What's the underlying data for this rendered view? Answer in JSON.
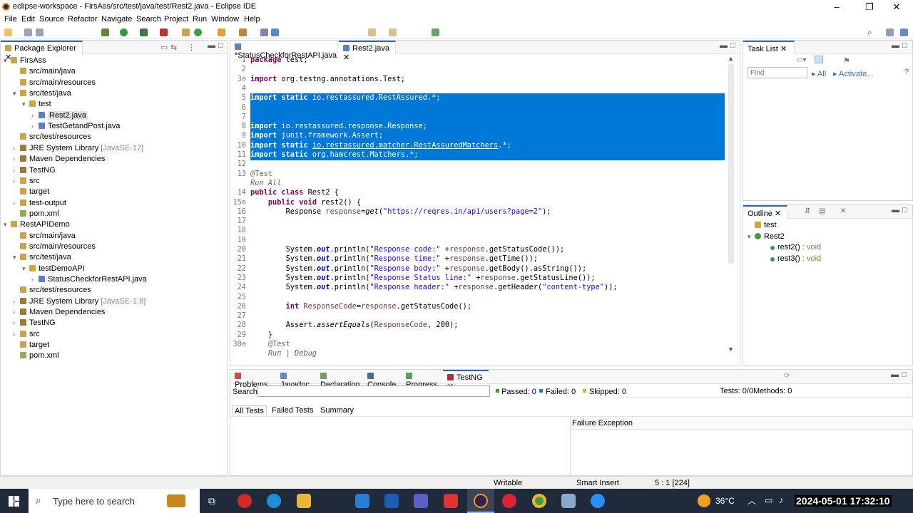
{
  "window": {
    "title": "eclipse-workspace - FirsAss/src/test/java/test/Rest2.java - Eclipse IDE"
  },
  "menu": [
    "File",
    "Edit",
    "Source",
    "Refactor",
    "Navigate",
    "Search",
    "Project",
    "Run",
    "Window",
    "Help"
  ],
  "package_explorer": {
    "title": "Package Explorer",
    "items": [
      {
        "label": "FirsAss",
        "depth": 0,
        "arrow": "▾",
        "icon": "project"
      },
      {
        "label": "src/main/java",
        "depth": 1,
        "arrow": "",
        "icon": "folder"
      },
      {
        "label": "src/main/resources",
        "depth": 1,
        "arrow": "",
        "icon": "folder"
      },
      {
        "label": "src/test/java",
        "depth": 1,
        "arrow": "▾",
        "icon": "folder"
      },
      {
        "label": "test",
        "depth": 2,
        "arrow": "▾",
        "icon": "package"
      },
      {
        "label": "Rest2.java",
        "depth": 3,
        "arrow": "›",
        "icon": "java",
        "selected": true
      },
      {
        "label": "TestGetandPost.java",
        "depth": 3,
        "arrow": "›",
        "icon": "java"
      },
      {
        "label": "src/test/resources",
        "depth": 1,
        "arrow": "",
        "icon": "folder"
      },
      {
        "label": "JRE System Library",
        "suffix": "[JavaSE-17]",
        "depth": 1,
        "arrow": "›",
        "icon": "library"
      },
      {
        "label": "Maven Dependencies",
        "depth": 1,
        "arrow": "›",
        "icon": "library"
      },
      {
        "label": "TestNG",
        "depth": 1,
        "arrow": "›",
        "icon": "library"
      },
      {
        "label": "src",
        "depth": 1,
        "arrow": "›",
        "icon": "folder"
      },
      {
        "label": "target",
        "depth": 1,
        "arrow": "",
        "icon": "folder"
      },
      {
        "label": "test-output",
        "depth": 1,
        "arrow": "›",
        "icon": "folder"
      },
      {
        "label": "pom.xml",
        "depth": 1,
        "arrow": "",
        "icon": "xml"
      },
      {
        "label": "RestAPIDemo",
        "depth": 0,
        "arrow": "▾",
        "icon": "project"
      },
      {
        "label": "src/main/java",
        "depth": 1,
        "arrow": "",
        "icon": "folder"
      },
      {
        "label": "src/main/resources",
        "depth": 1,
        "arrow": "",
        "icon": "folder"
      },
      {
        "label": "src/test/java",
        "depth": 1,
        "arrow": "▾",
        "icon": "folder"
      },
      {
        "label": "testDemoAPI",
        "depth": 2,
        "arrow": "▾",
        "icon": "package"
      },
      {
        "label": "StatusCheckforRestAPI.java",
        "depth": 3,
        "arrow": "›",
        "icon": "java"
      },
      {
        "label": "src/test/resources",
        "depth": 1,
        "arrow": "",
        "icon": "folder"
      },
      {
        "label": "JRE System Library",
        "suffix": "[JavaSE-1.8]",
        "depth": 1,
        "arrow": "›",
        "icon": "library"
      },
      {
        "label": "Maven Dependencies",
        "depth": 1,
        "arrow": "›",
        "icon": "library"
      },
      {
        "label": "TestNG",
        "depth": 1,
        "arrow": "›",
        "icon": "library"
      },
      {
        "label": "src",
        "depth": 1,
        "arrow": "›",
        "icon": "folder"
      },
      {
        "label": "target",
        "depth": 1,
        "arrow": "",
        "icon": "folder"
      },
      {
        "label": "pom.xml",
        "depth": 1,
        "arrow": "",
        "icon": "xml"
      }
    ]
  },
  "editor": {
    "tabs": [
      {
        "label": "*StatusCheckforRestAPI.java",
        "active": false
      },
      {
        "label": "Rest2.java",
        "active": true
      }
    ],
    "lines": [
      {
        "n": "1",
        "html": "<span class='kw'>package</span> test;"
      },
      {
        "n": "2",
        "html": ""
      },
      {
        "n": "3⊖",
        "html": "<span class='kw'>import</span> org.testng.annotations.Test;"
      },
      {
        "n": "4",
        "html": ""
      },
      {
        "n": "5",
        "html": "<span class='kw'>import</span> <span class='kw'>static</span> io.restassured.RestAssured.*;",
        "sel": true
      },
      {
        "n": "6",
        "html": "",
        "sel": true
      },
      {
        "n": "7",
        "html": "",
        "sel": true
      },
      {
        "n": "8",
        "html": "<span class='kw'>import</span> io.restassured.response.Response;",
        "sel": true
      },
      {
        "n": "9",
        "html": "<span class='kw'>import</span> junit.framework.Assert;",
        "sel": true
      },
      {
        "n": "10",
        "html": "<span class='kw'>import</span> <span class='kw'>static</span> <u>io.restassured.matcher.RestAssuredMatchers</u>.*;",
        "sel": true
      },
      {
        "n": "11",
        "html": "<span class='kw'>import</span> <span class='kw'>static</span> org.hamcrest.Matchers.*;",
        "sel": true
      },
      {
        "n": "12",
        "html": ""
      },
      {
        "n": "13",
        "html": "<span class='ann'>@Test</span>"
      },
      {
        "n": "",
        "html": "<span class='ann italic'>Run All</span>"
      },
      {
        "n": "14",
        "html": "<span class='kw'>public</span> <span class='kw'>class</span> Rest2 {"
      },
      {
        "n": "15⊖",
        "html": "    <span class='kw'>public</span> <span class='kw'>void</span> rest2() {"
      },
      {
        "n": "16",
        "html": "        Response <span class='var'>response</span>=<span class='italic'>get</span>(<span class='str'>\"https://reqres.in/api/users?page=2\"</span>);"
      },
      {
        "n": "17",
        "html": ""
      },
      {
        "n": "18",
        "html": ""
      },
      {
        "n": "19",
        "html": ""
      },
      {
        "n": "20",
        "html": "        System.<span class='fieldc'>out</span>.println(<span class='str'>\"Response code:\"</span> +<span class='var'>response</span>.getStatusCode());"
      },
      {
        "n": "21",
        "html": "        System.<span class='fieldc'>out</span>.println(<span class='str'>\"Response time:\"</span> +<span class='var'>response</span>.getTime());"
      },
      {
        "n": "22",
        "html": "        System.<span class='fieldc'>out</span>.println(<span class='str'>\"Response body:\"</span> +<span class='var'>response</span>.getBody().asString());"
      },
      {
        "n": "23",
        "html": "        System.<span class='fieldc'>out</span>.println(<span class='str'>\"Response Status line:\"</span> +<span class='var'>response</span>.getStatusLine());"
      },
      {
        "n": "24",
        "html": "        System.<span class='fieldc'>out</span>.println(<span class='str'>\"Response header:\"</span> +<span class='var'>response</span>.getHeader(<span class='str'>\"content-type\"</span>));"
      },
      {
        "n": "25",
        "html": ""
      },
      {
        "n": "26",
        "html": "        <span class='kw'>int</span> <span class='var'>ResponseCode</span>=<span class='var'>response</span>.getStatusCode();"
      },
      {
        "n": "27",
        "html": ""
      },
      {
        "n": "28",
        "html": "        Assert.<span class='italic'>assertEquals</span>(<span class='var'>ResponseCode</span>, 200);"
      },
      {
        "n": "29",
        "html": "    }"
      },
      {
        "n": "30⊖",
        "html": "    <span class='ann'>@Test</span>"
      },
      {
        "n": "",
        "html": "    <span class='ann italic'>Run | Debug</span>"
      }
    ]
  },
  "task_list": {
    "title": "Task List",
    "find_placeholder": "Find",
    "all": "All",
    "activate": "Activate..."
  },
  "outline": {
    "title": "Outline",
    "items": [
      {
        "label": "test",
        "depth": 0,
        "icon": "package"
      },
      {
        "label": "Rest2",
        "depth": 0,
        "icon": "class",
        "arrow": "▾"
      },
      {
        "label": "rest2()",
        "suffix": " : void",
        "depth": 1,
        "icon": "method"
      },
      {
        "label": "rest3()",
        "suffix": " : void",
        "depth": 1,
        "icon": "method"
      }
    ]
  },
  "bottom": {
    "tabs": [
      "Problems",
      "Javadoc",
      "Declaration",
      "Console",
      "Progress",
      "TestNG"
    ],
    "search_label": "Search:",
    "passed": "Passed: 0",
    "failed": "Failed: 0",
    "skipped": "Skipped: 0",
    "tests": "Tests: 0/0",
    "methods": "Methods: 0",
    "subtabs": [
      "All Tests",
      "Failed Tests",
      "Summary"
    ],
    "failure_title": "Failure Exception"
  },
  "status": {
    "writable": "Writable",
    "insert": "Smart Insert",
    "position": "5 : 1 [224]"
  },
  "taskbar": {
    "search": "Type here to search",
    "temp": "36°C",
    "datetime": "2024-05-01  17:32:10"
  },
  "colors": {
    "selection": "#0078d7",
    "keyword": "#7f0055",
    "string": "#2a00ff",
    "taskbar": "#1f2a3a"
  }
}
